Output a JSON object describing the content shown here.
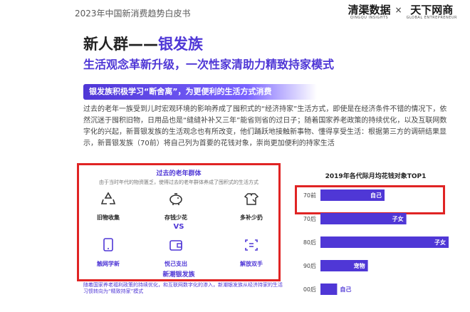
{
  "header": {
    "report_title": "2023年中国新消费趋势白皮书",
    "brand_1": {
      "name": "清渠数据",
      "sub": "QINGQU INSIGHTS"
    },
    "separator": "×",
    "brand_2": {
      "name": "天下网商",
      "sub": "GLOBAL ENTREPRENEUR"
    }
  },
  "title": {
    "prefix": "新人群——",
    "accent": "银发族"
  },
  "subtitle": "生活观念革新升级，一次性家清助力精致持家模式",
  "banner": "银发族积极学习“断舍离”，为更便利的生活方式消费",
  "paragraph": "过去的老年一族受到儿时宏观环境的影响养成了囤积式的“经济持家”生活方式，即使是在经济条件不错的情况下，依然沉迷于囤积旧物，日用品也是“缝缝补补又三年”能省则省的过日子；随着国家养老政策的持续优化，以及互联网数字化的兴起，新晋银发族的生活观念也有所改变，他们踊跃地接触新事物、懂得享受生活：根据第三方的调研结果显示，新晋银发族（70前）将自己列为首要的花钱对象，崇尚更加便利的持家生活",
  "comparison": {
    "old_title": "过去的老年群体",
    "old_desc": "由于当时年代的物资匮乏，使得过去的老年群体养成了囤积式的生活方式",
    "old_items": [
      {
        "label": "旧物收集",
        "icon": "recycle-icon"
      },
      {
        "label": "存钱少花",
        "icon": "piggy-bank-icon"
      },
      {
        "label": "多补少扔",
        "icon": "patched-shirt-icon"
      }
    ],
    "vs": "VS",
    "new_items": [
      {
        "label": "触网学新",
        "icon": "touch-screen-icon"
      },
      {
        "label": "悦己支出",
        "icon": "wallet-icon"
      },
      {
        "label": "解放双手",
        "icon": "hands-free-icon"
      }
    ],
    "new_title": "新潮银发族",
    "footnote": "随着国家养老福利政策的持续优化，和互联网数字化的渗入，新潮银发族从经济持家的生活习惯转向为“精致持家”模式"
  },
  "colors": {
    "accent": "#4f37d6",
    "highlight": "#e02424"
  },
  "chart_data": {
    "type": "bar",
    "orientation": "horizontal",
    "title": "2019年各代际月均花钱对象TOP1",
    "categories": [
      "70前",
      "70后",
      "80后",
      "90后",
      "00后"
    ],
    "values": [
      0.5,
      0.67,
      1.0,
      0.37,
      0.13
    ],
    "value_labels": [
      "自己",
      "子女",
      "子女",
      "宠物",
      "自己"
    ],
    "label_inside": [
      true,
      true,
      true,
      true,
      false
    ],
    "bar_color": "#4f37d6",
    "axis": false,
    "grid": false
  }
}
